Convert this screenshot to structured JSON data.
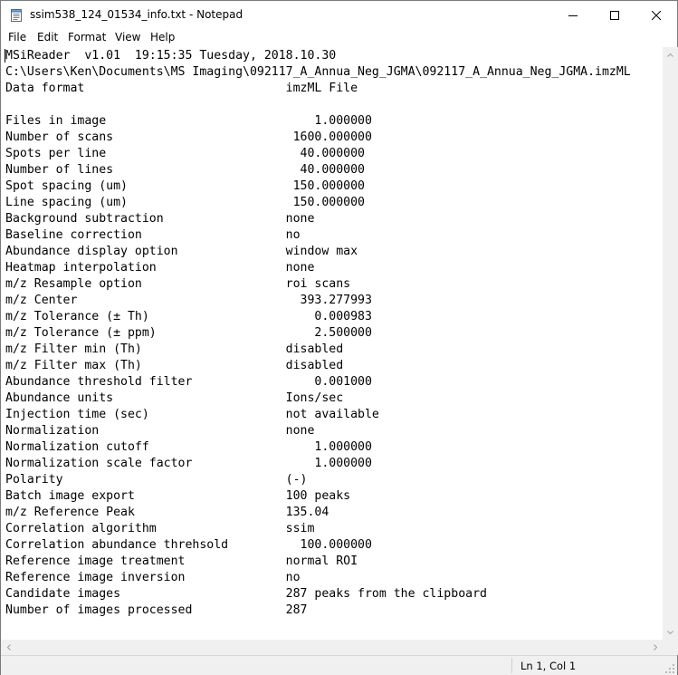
{
  "window": {
    "title": "ssim538_124_01534_info.txt - Notepad",
    "icon": "notepad-icon",
    "controls": [
      "minimize-icon",
      "maximize-icon",
      "close-icon"
    ]
  },
  "menu": {
    "file": "File",
    "edit": "Edit",
    "format": "Format",
    "view": "View",
    "help": "Help"
  },
  "document": {
    "lines": [
      "MSiReader  v1.01  19:15:35 Tuesday, 2018.10.30",
      "C:\\Users\\Ken\\Documents\\MS Imaging\\092117_A_Annua_Neg_JGMA\\092117_A_Annua_Neg_JGMA.imzML",
      "Data format                            imzML File",
      "",
      "Files in image                             1.000000",
      "Number of scans                         1600.000000",
      "Spots per line                           40.000000",
      "Number of lines                          40.000000",
      "Spot spacing (um)                       150.000000",
      "Line spacing (um)                       150.000000",
      "Background subtraction                 none",
      "Baseline correction                    no",
      "Abundance display option               window max",
      "Heatmap interpolation                  none",
      "m/z Resample option                    roi scans",
      "m/z Center                               393.277993",
      "m/z Tolerance (± Th)                       0.000983",
      "m/z Tolerance (± ppm)                      2.500000",
      "m/z Filter min (Th)                    disabled",
      "m/z Filter max (Th)                    disabled",
      "Abundance threshold filter                 0.001000",
      "Abundance units                        Ions/sec",
      "Injection time (sec)                   not available",
      "Normalization                          none",
      "Normalization cutoff                       1.000000",
      "Normalization scale factor                 1.000000",
      "Polarity                               (-)",
      "Batch image export                     100 peaks",
      "m/z Reference Peak                     135.04",
      "Correlation algorithm                  ssim",
      "Correlation abundance threhsold          100.000000",
      "Reference image treatment              normal ROI",
      "Reference image inversion              no",
      "Candidate images                       287 peaks from the clipboard",
      "Number of images processed             287"
    ]
  },
  "status": {
    "position": "Ln 1, Col 1"
  },
  "colors": {
    "chrome": "#f0f0f0",
    "text": "#000000",
    "border": "#7a7a7a"
  }
}
